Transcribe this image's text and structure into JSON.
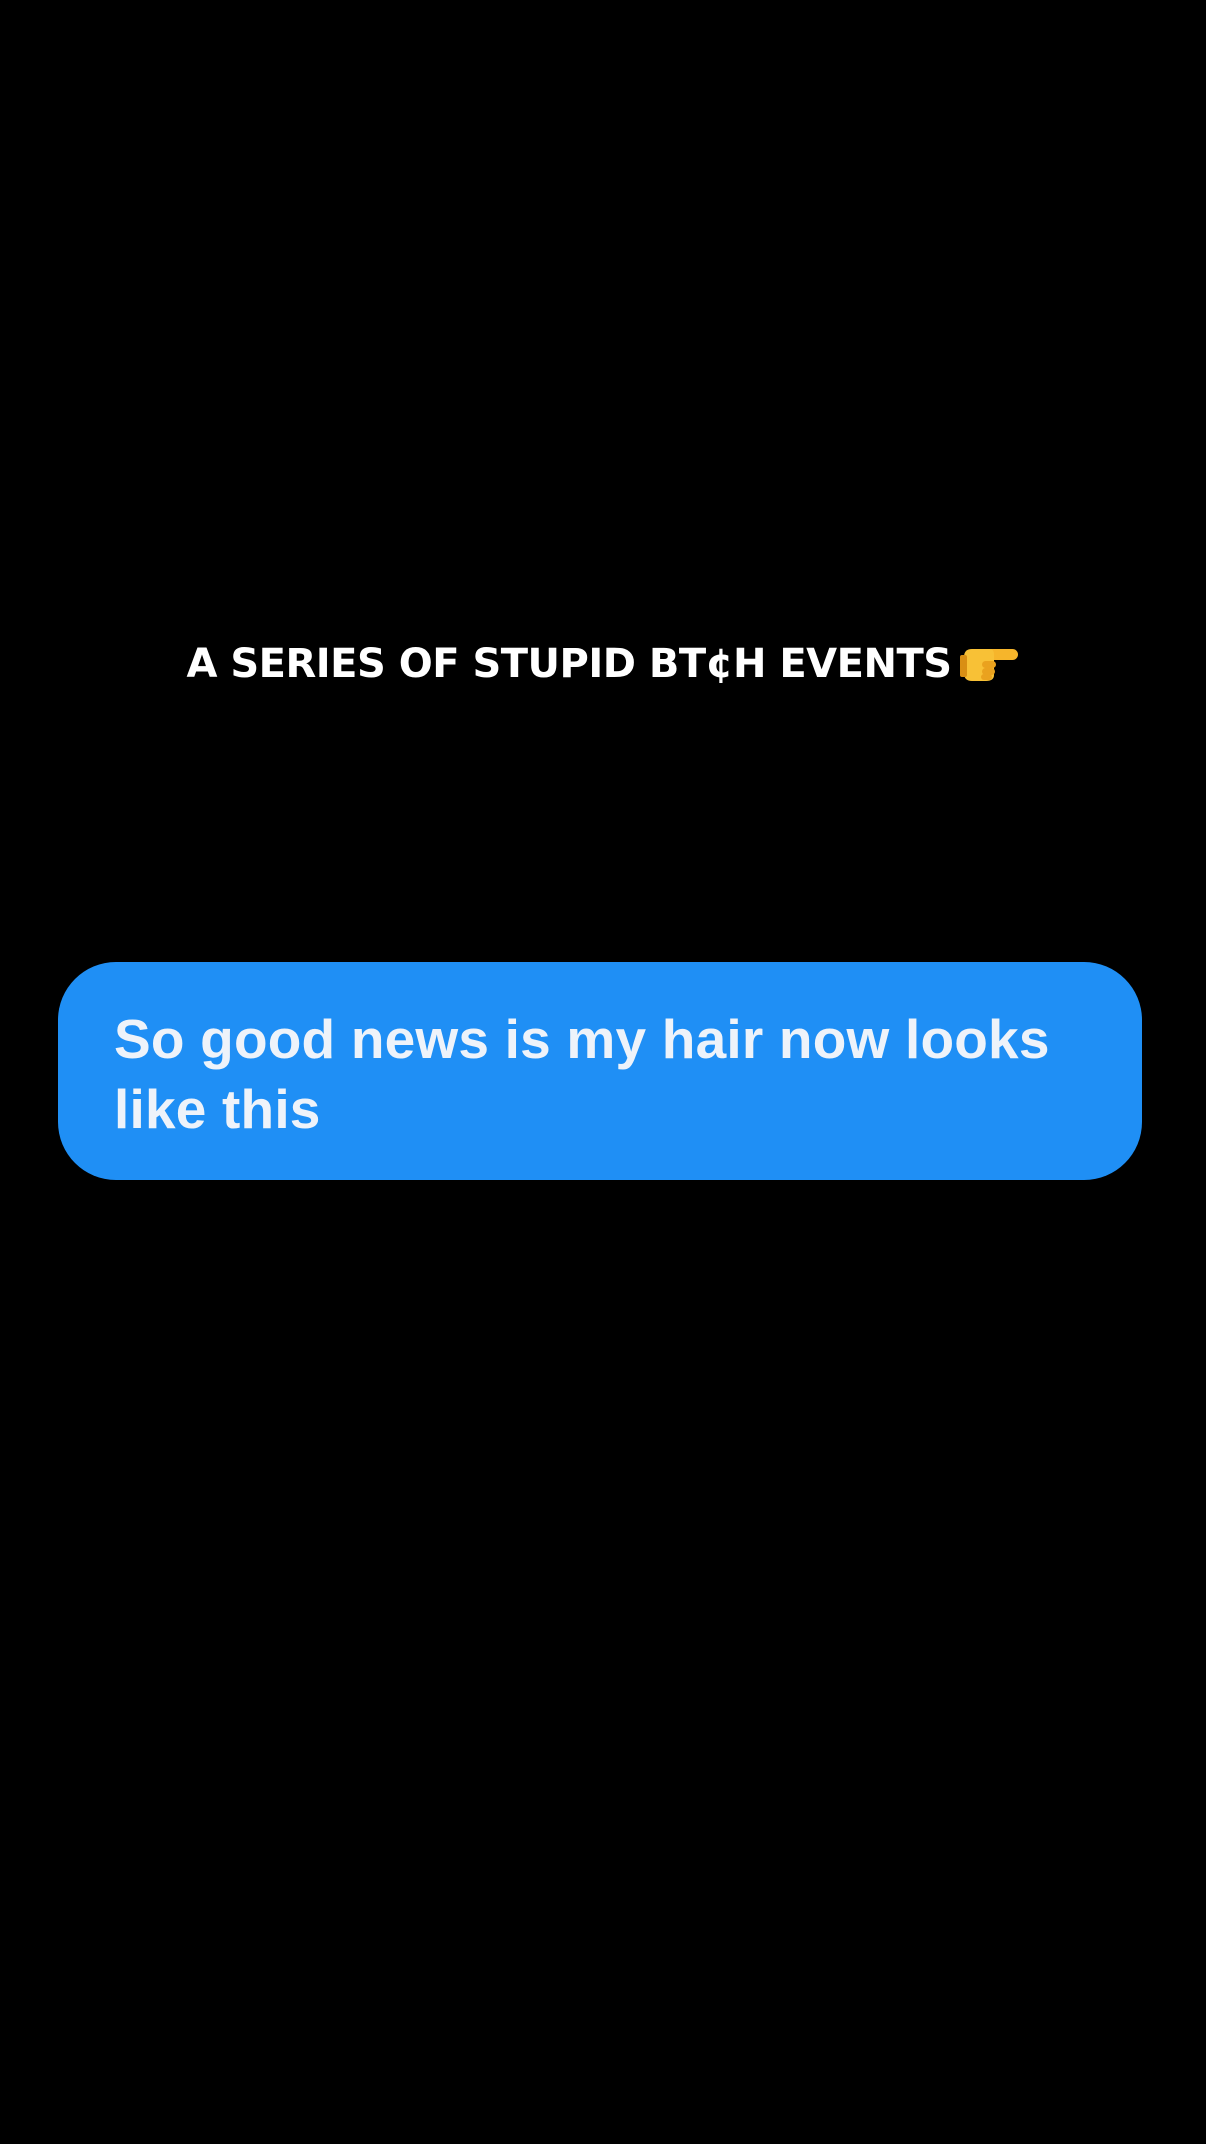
{
  "caption": {
    "text": "A SERIES OF STUPID BT¢H EVENTS",
    "icon": "pointing-right-hand-icon"
  },
  "message": {
    "text": "So good news is my hair now looks like this",
    "bubble_color": "#1f8ff5",
    "text_color": "#eef3fa"
  },
  "background_color": "#000000"
}
